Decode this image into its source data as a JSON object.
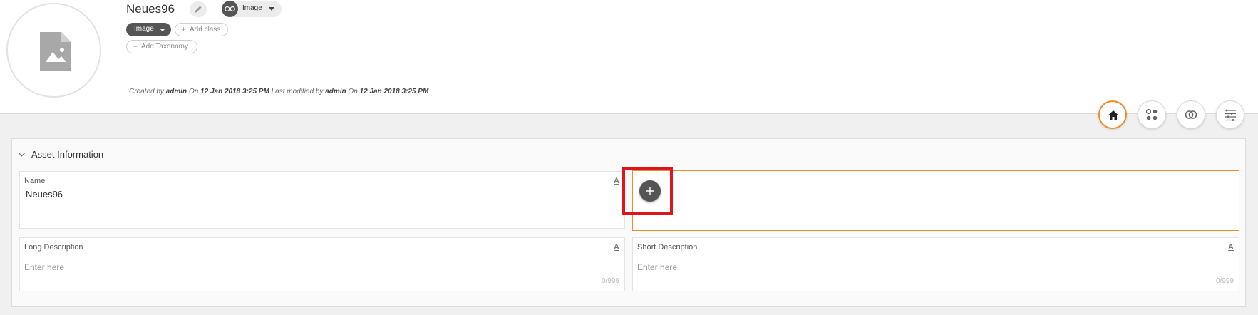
{
  "header": {
    "title": "Neues96",
    "type_label": "Image",
    "class_chip": "Image",
    "add_class": "Add class",
    "add_taxonomy": "Add Taxonomy",
    "meta": {
      "created_prefix": "Created by",
      "created_by": "admin",
      "on1": "On",
      "created_at": "12 Jan 2018 3:25 PM",
      "modified_prefix": "Last modified by",
      "modified_by": "admin",
      "on2": "On",
      "modified_at": "12 Jan 2018 3:25 PM"
    }
  },
  "nav": [
    "home-icon",
    "apps-icon",
    "relationships-icon",
    "list-settings-icon"
  ],
  "section": {
    "title": "Asset Information",
    "fields": {
      "name": {
        "label": "Name",
        "value": "Neues96",
        "icon": "A"
      },
      "long_description": {
        "label": "Long Description",
        "placeholder": "Enter here",
        "icon": "A",
        "counter": "0/999"
      },
      "short_description": {
        "label": "Short Description",
        "placeholder": "Enter here",
        "icon": "A",
        "counter": "0/999"
      }
    }
  },
  "colors": {
    "accent": "#f08b2c",
    "highlight": "#e0141c",
    "chip": "#555555"
  }
}
